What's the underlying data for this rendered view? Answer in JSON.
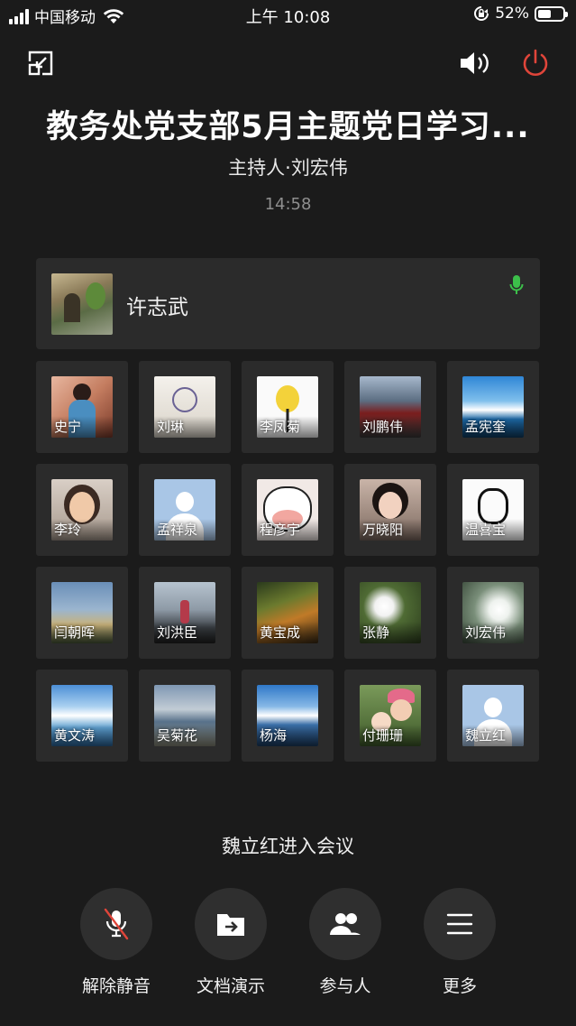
{
  "status_bar": {
    "carrier": "中国移动",
    "time": "上午 10:08",
    "battery": "52%",
    "battery_level": 0.52
  },
  "meeting": {
    "title": "教务处党支部5月主题党日学习...",
    "host": "主持人·刘宏伟",
    "duration": "14:58"
  },
  "active_speaker": {
    "name": "许志武",
    "mic_icon": "microphone-icon",
    "mic_color": "#3cbf4a"
  },
  "participants": [
    {
      "name": "史宁"
    },
    {
      "name": "刘琳"
    },
    {
      "name": "李凤菊"
    },
    {
      "name": "刘鹏伟"
    },
    {
      "name": "孟宪奎"
    },
    {
      "name": "李玲"
    },
    {
      "name": "孟祥泉"
    },
    {
      "name": "程彦宇"
    },
    {
      "name": "万晓阳"
    },
    {
      "name": "温喜宝"
    },
    {
      "name": "闫朝晖"
    },
    {
      "name": "刘洪臣"
    },
    {
      "name": "黄宝成"
    },
    {
      "name": "张静"
    },
    {
      "name": "刘宏伟"
    },
    {
      "name": "黄文涛"
    },
    {
      "name": "吴菊花"
    },
    {
      "name": "杨海"
    },
    {
      "name": "付珊珊"
    },
    {
      "name": "魏立红"
    }
  ],
  "notice": "魏立红进入会议",
  "controls": {
    "unmute": "解除静音",
    "share_doc": "文档演示",
    "participants": "参与人",
    "more": "更多"
  },
  "colors": {
    "background": "#1b1b1b",
    "tile": "#2b2b2b",
    "power": "#e0453a"
  }
}
